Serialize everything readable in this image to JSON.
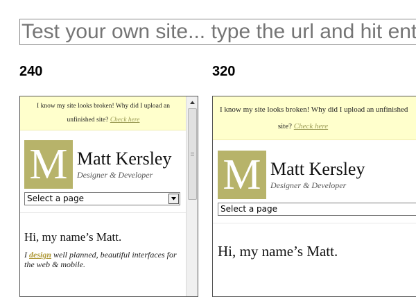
{
  "url_bar": {
    "placeholder": "Test your own site... type the url and hit enter"
  },
  "previews": [
    {
      "width_label": "240",
      "notice_text": "I know my site looks broken! Why did I upload an unfinished site?",
      "notice_link": "Check here",
      "logo_letter": "M",
      "name": "Matt Kersley",
      "tagline": "Designer & Developer",
      "select_value": "Select a page",
      "greeting": "Hi, my name’s Matt.",
      "intro_prefix": "I ",
      "intro_link": "design",
      "intro_rest": " well planned, beautiful interfaces for the web & mobile."
    },
    {
      "width_label": "320",
      "notice_text": "I know my site looks broken! Why did I upload an unfinished",
      "notice_text2": "site?",
      "notice_link": "Check here",
      "logo_letter": "M",
      "name": "Matt Kersley",
      "tagline": "Designer & Developer",
      "select_value": "Select a page",
      "greeting": "Hi, my name’s Matt."
    }
  ],
  "colors": {
    "notice_bg": "#ffffcc",
    "logo_bg": "#b7b36a",
    "link": "#9b9b55"
  }
}
